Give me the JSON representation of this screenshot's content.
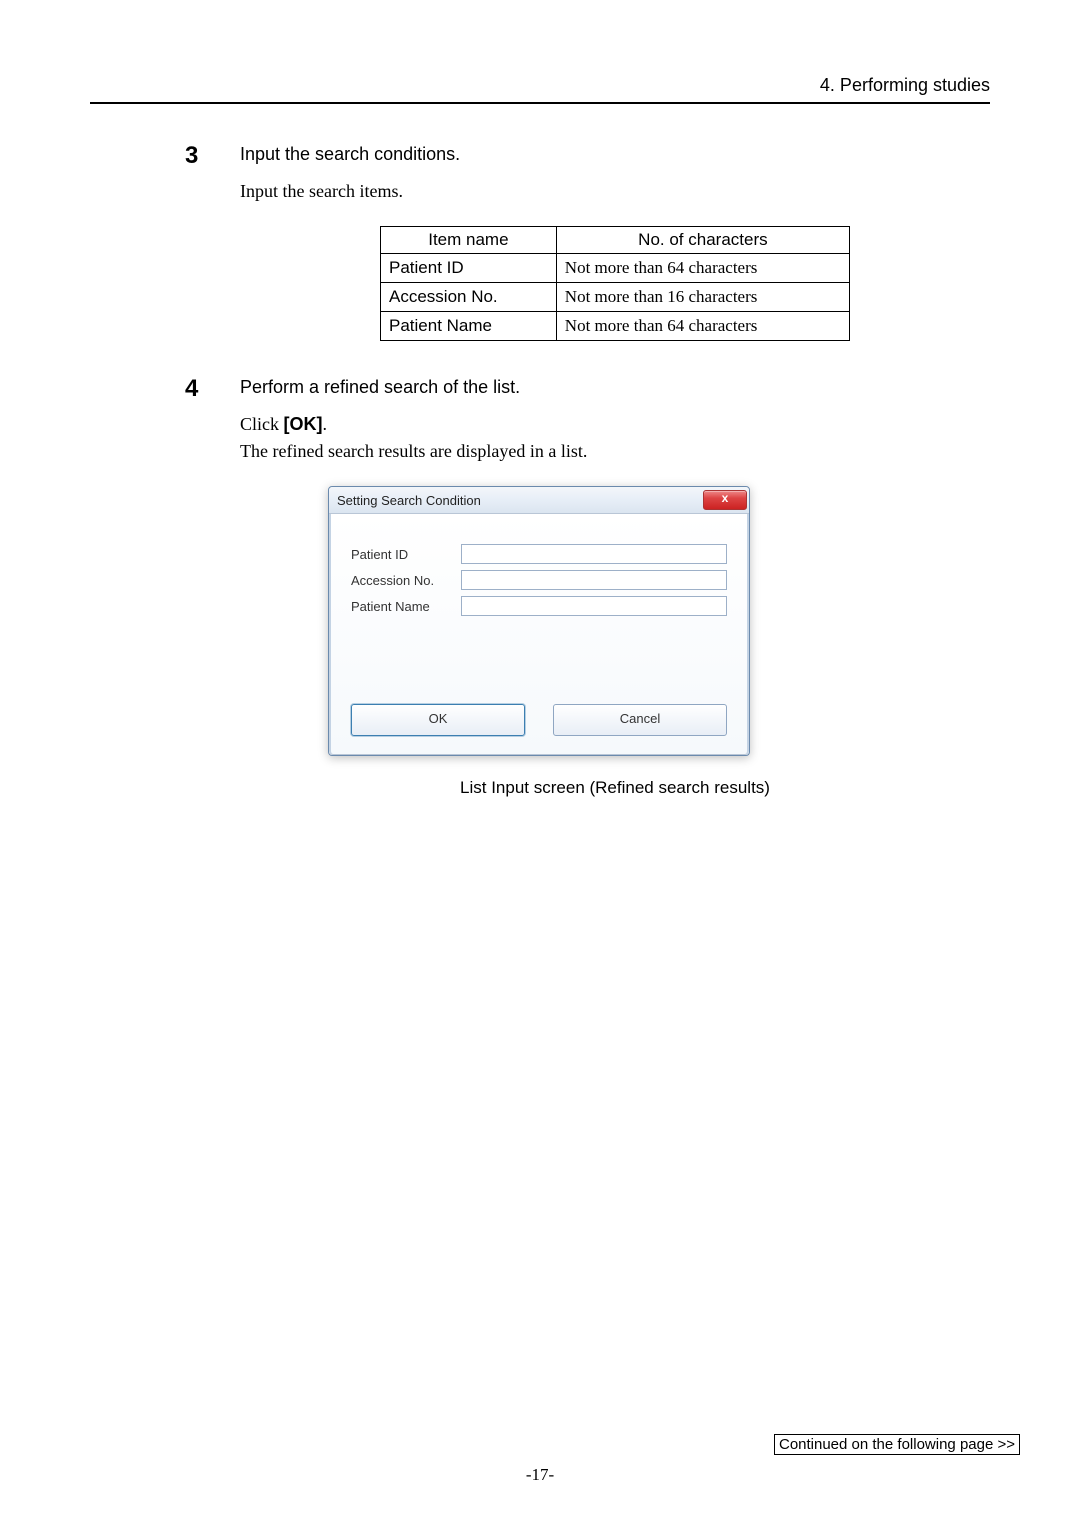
{
  "header": "4. Performing studies",
  "steps": {
    "s3": {
      "num": "3",
      "title": "Input the search conditions.",
      "text": "Input the search items."
    },
    "s4": {
      "num": "4",
      "title": "Perform a refined search of the list.",
      "click_prefix": "Click ",
      "ok_label": "[OK]",
      "dot": ".",
      "text2": "The refined search results are displayed in a list."
    }
  },
  "param_table": {
    "headers": {
      "c1": "Item name",
      "c2": "No. of characters"
    },
    "rows": [
      {
        "c1": "Patient ID",
        "c2": "Not more than 64 characters"
      },
      {
        "c1": "Accession No.",
        "c2": "Not more than 16 characters"
      },
      {
        "c1": "Patient Name",
        "c2": "Not more than 64 characters"
      }
    ]
  },
  "dialog": {
    "title": "Setting Search Condition",
    "close": "x",
    "labels": {
      "pid": "Patient ID",
      "acc": "Accession No.",
      "pname": "Patient Name"
    },
    "buttons": {
      "ok": "OK",
      "cancel": "Cancel"
    },
    "caption": "List Input screen (Refined search results)"
  },
  "footer": "Continued on the following page >>",
  "page_num": "-17-"
}
